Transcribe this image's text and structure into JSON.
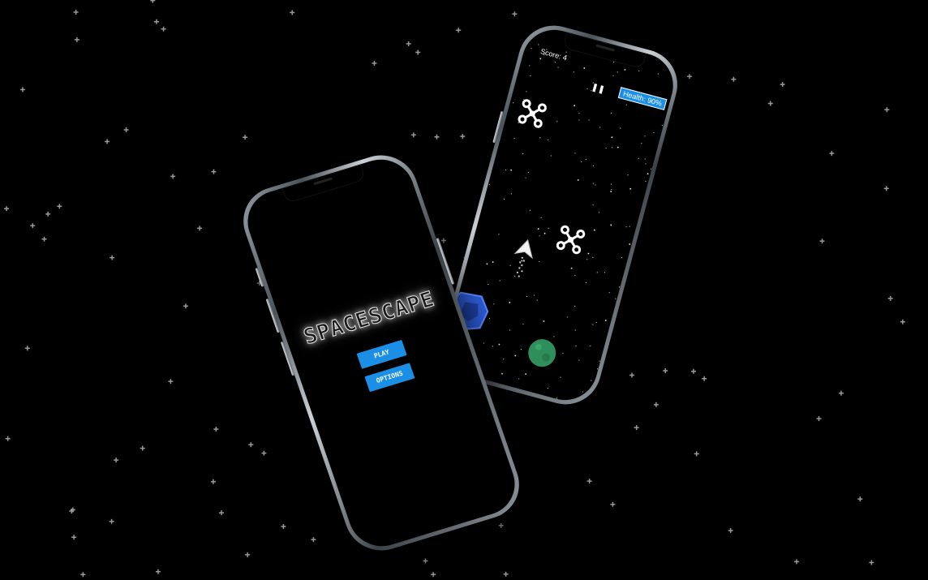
{
  "colors": {
    "background": "#000000",
    "button_blue": "#1b8fe6",
    "health_blue": "#1b8fe6",
    "asteroid_blue": "#2c5bd6",
    "planet_green": "#2f8f5b"
  },
  "menu_screen": {
    "title": "SPACESCAPE",
    "play_label": "PLAY",
    "options_label": "OPTIONS"
  },
  "game_screen": {
    "score_label": "Score: 4",
    "pause_icon": "pause-icon",
    "health_label": "Health: 90%",
    "sprites": [
      "enemy-drone-icon",
      "enemy-drone-icon",
      "player-ship-icon",
      "asteroid-icon",
      "planet-icon"
    ]
  }
}
